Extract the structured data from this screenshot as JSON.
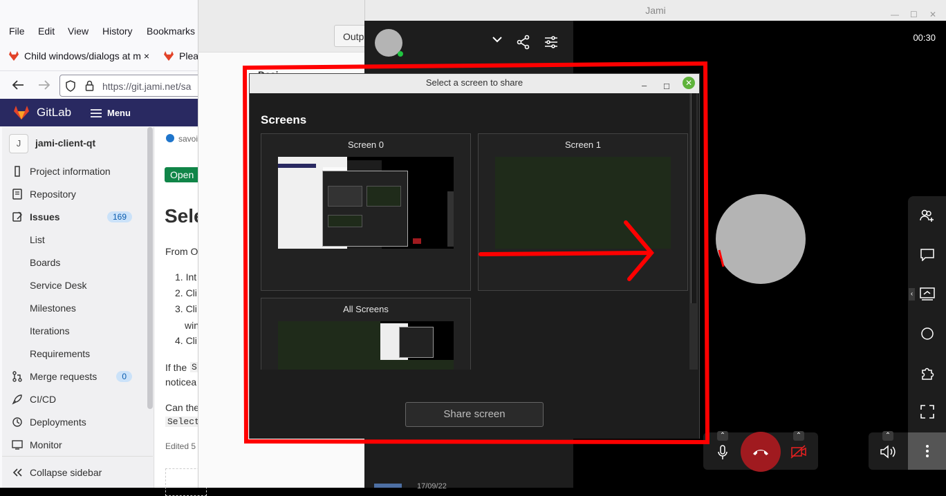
{
  "firefox": {
    "menu": [
      "File",
      "Edit",
      "View",
      "History",
      "Bookmarks"
    ],
    "tabs": [
      {
        "label": "Child windows/dialogs at m",
        "close": "×"
      },
      {
        "label": "Plea"
      }
    ],
    "url": "https://git.jami.net/sa"
  },
  "gitlab": {
    "brand": "GitLab",
    "menu_label": "Menu",
    "project_initial": "J",
    "project_name": "jami-client-qt",
    "nav": [
      {
        "label": "Project information"
      },
      {
        "label": "Repository"
      },
      {
        "label": "Issues",
        "badge": "169"
      },
      {
        "label": "List"
      },
      {
        "label": "Boards"
      },
      {
        "label": "Service Desk"
      },
      {
        "label": "Milestones"
      },
      {
        "label": "Iterations"
      },
      {
        "label": "Requirements"
      },
      {
        "label": "Merge requests",
        "badge": "0"
      },
      {
        "label": "CI/CD"
      },
      {
        "label": "Deployments"
      },
      {
        "label": "Monitor"
      }
    ],
    "collapse": "Collapse sidebar",
    "issue": {
      "author": "savoi",
      "status": "Open",
      "title": "Sele",
      "from": "From O",
      "steps": [
        "1. Int",
        "2. Cli",
        "3. Cli",
        "win",
        "4. Cli"
      ],
      "if_line_1": "If the",
      "if_code": "S",
      "if_line_2": "noticea",
      "can_line": "Can the",
      "code": "Select",
      "edited": "Edited 5"
    }
  },
  "win2": {
    "tab_label": "Outp",
    "heading": "Desi"
  },
  "jami": {
    "title": "Jami",
    "call_time": "00:30",
    "bottom_date": "17/09/22",
    "dialog": {
      "title": "Select a screen to share",
      "heading": "Screens",
      "screens": [
        "Screen 0",
        "Screen 1",
        "All Screens"
      ],
      "share_button": "Share screen"
    },
    "colors": {
      "annotation": "#ff0000",
      "hangup": "#a01a1f",
      "accent": "#5fb33b"
    }
  }
}
